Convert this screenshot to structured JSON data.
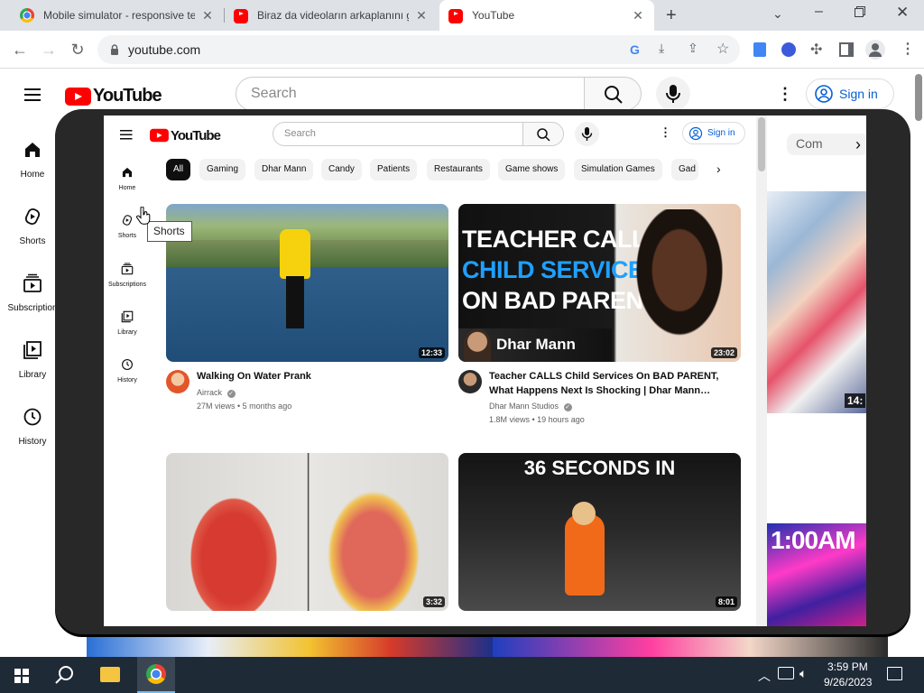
{
  "browser": {
    "tabs": [
      {
        "title": "Mobile simulator - responsive te",
        "active": false
      },
      {
        "title": "Biraz da videoların arkaplanını gö",
        "active": false
      },
      {
        "title": "YouTube",
        "active": true
      }
    ],
    "url": "youtube.com"
  },
  "background_page": {
    "logo": "YouTube",
    "search_placeholder": "Search",
    "signin_label": "Sign in",
    "sidebar": [
      "Home",
      "Shorts",
      "Subscription",
      "Library",
      "History"
    ],
    "chip_partial": "Com"
  },
  "simulator": {
    "logo": "YouTube",
    "search_placeholder": "Search",
    "signin_label": "Sign in",
    "sidebar": [
      "Home",
      "Shorts",
      "Subscriptions",
      "Library",
      "History"
    ],
    "chips": [
      "All",
      "Gaming",
      "Dhar Mann",
      "Candy",
      "Patients",
      "Restaurants",
      "Game shows",
      "Simulation Games",
      "Gad"
    ],
    "tooltip": "Shorts",
    "videos": [
      {
        "title": "Walking On Water Prank",
        "channel": "Airrack",
        "meta": "27M views • 5 months ago",
        "duration": "12:33"
      },
      {
        "title_line1": "Teacher CALLS Child Services On BAD PARENT,",
        "title_line2": "What Happens Next Is Shocking | Dhar Mann…",
        "channel": "Dhar Mann Studios",
        "meta": "1.8M views • 19 hours ago",
        "duration": "23:02",
        "thumb_lines": [
          "TEACHER CALLS",
          "CHILD SERVICES",
          "ON BAD PARENT"
        ],
        "thumb_brand": "Dhar Mann"
      },
      {
        "duration": "3:32"
      },
      {
        "duration": "8:01",
        "thumb_text": "36 SECONDS IN"
      }
    ],
    "right_pane": {
      "duration_partial": "14:",
      "thumb_text": "1:00AM"
    }
  },
  "taskbar": {
    "time": "3:59 PM",
    "date": "9/26/2023"
  }
}
